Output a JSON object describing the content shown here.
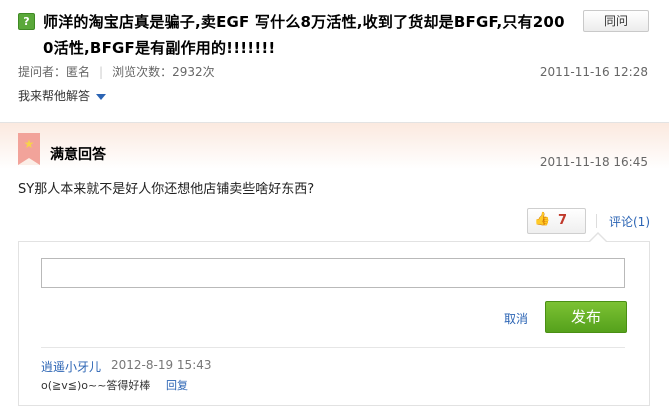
{
  "question": {
    "icon": "question-mark-icon",
    "icon_glyph": "?",
    "title": "师洋的淘宝店真是骗子,卖EGF 写什么8万活性,收到了货却是BFGF,只有2000活性,BFGF是有副作用的!!!!!!!",
    "same_button": "同问",
    "asker": "提问者：匿名",
    "views": "浏览次数：2932次",
    "date": "2011-11-16 12:28",
    "help_answer": "我来帮他解答"
  },
  "best_answer": {
    "icon": "flag-icon",
    "label": "满意回答",
    "date": "2011-11-18 16:45",
    "text": "SY那人本来就不是好人你还想他店铺卖些啥好东西?",
    "like_count": "7",
    "comment_link": "评论(1)"
  },
  "comment_form": {
    "input_value": "",
    "cancel": "取消",
    "publish": "发布"
  },
  "comments": [
    {
      "user": "逍遥小牙儿",
      "time": "2012-8-19 15:43",
      "text": "o(≧v≦)o~~答得好棒",
      "reply": "回复"
    }
  ],
  "colors": {
    "accent_green": "#5aa83a",
    "link_blue": "#2b64b4",
    "like_red": "#c0392b"
  }
}
